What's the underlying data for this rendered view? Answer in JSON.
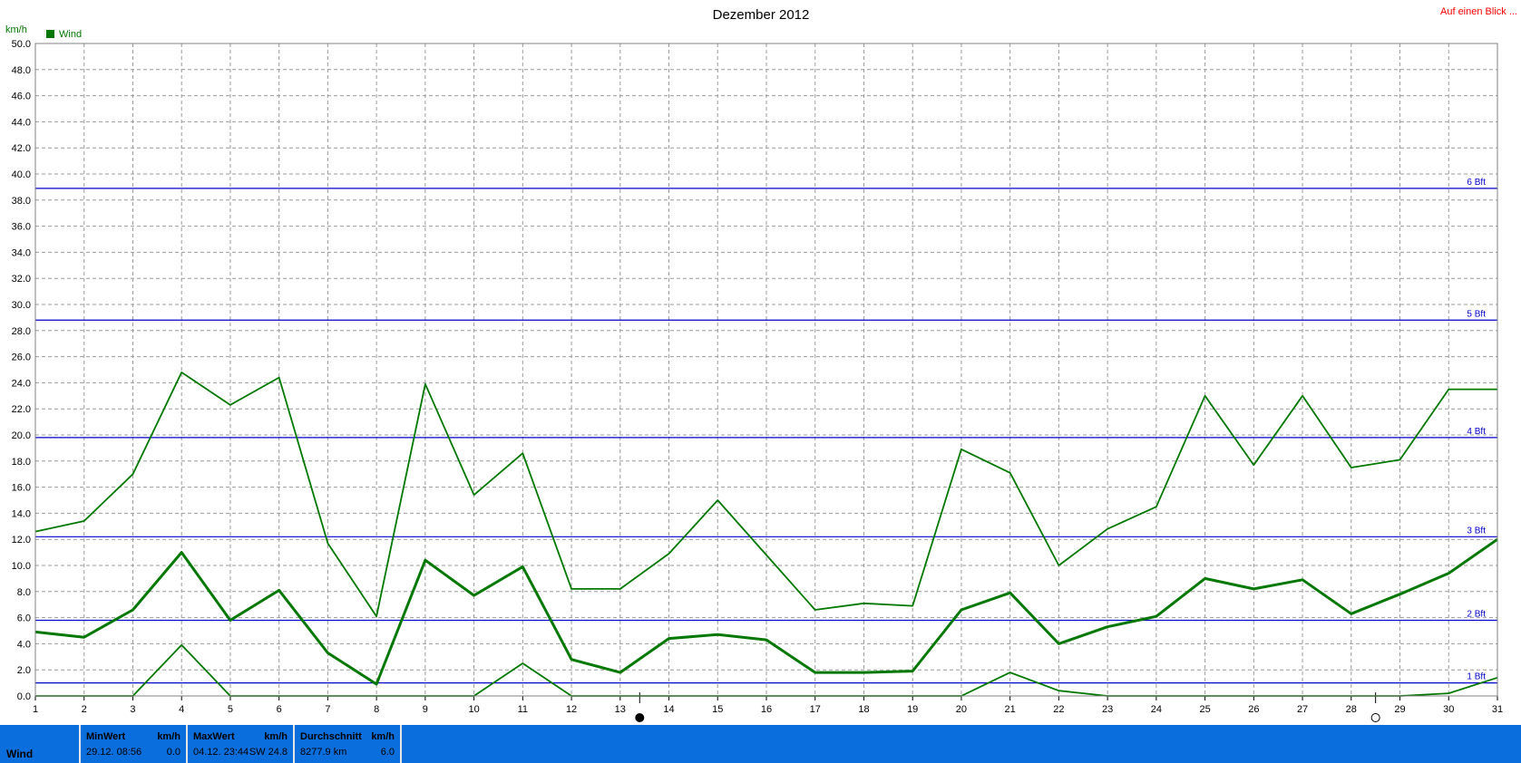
{
  "header": {
    "title": "Dezember 2012",
    "link": "Auf einen Blick ...",
    "y_unit": "km/h"
  },
  "legend": {
    "label": "Wind",
    "color": "#007800"
  },
  "chart_data": {
    "type": "line",
    "title": "Dezember 2012",
    "ylabel": "km/h",
    "ylim": [
      0,
      50
    ],
    "y_ticks": [
      "0.0",
      "2.0",
      "4.0",
      "6.0",
      "8.0",
      "10.0",
      "12.0",
      "14.0",
      "16.0",
      "18.0",
      "20.0",
      "22.0",
      "24.0",
      "26.0",
      "28.0",
      "30.0",
      "32.0",
      "34.0",
      "36.0",
      "38.0",
      "40.0",
      "42.0",
      "44.0",
      "46.0",
      "48.0",
      "50.0"
    ],
    "x": [
      1,
      2,
      3,
      4,
      5,
      6,
      7,
      8,
      9,
      10,
      11,
      12,
      13,
      14,
      15,
      16,
      17,
      18,
      19,
      20,
      21,
      22,
      23,
      24,
      25,
      26,
      27,
      28,
      29,
      30,
      31
    ],
    "grid": true,
    "legend_position": "top-left",
    "series": [
      {
        "name": "Wind",
        "role": "max",
        "color": "#007800",
        "values": [
          12.6,
          13.4,
          17.0,
          24.8,
          22.3,
          24.4,
          11.7,
          6.1,
          23.9,
          15.4,
          18.6,
          8.2,
          8.2,
          10.9,
          15.0,
          10.8,
          6.6,
          7.1,
          6.9,
          18.9,
          17.1,
          10.0,
          12.8,
          14.5,
          23.0,
          17.7,
          23.0,
          17.5,
          18.1,
          23.5,
          23.5
        ]
      },
      {
        "role": "average",
        "color": "#007800",
        "values": [
          4.9,
          4.5,
          6.6,
          11.0,
          5.8,
          8.1,
          3.3,
          0.9,
          10.4,
          7.7,
          9.9,
          2.8,
          1.8,
          4.4,
          4.7,
          4.3,
          1.8,
          1.8,
          1.9,
          6.6,
          7.9,
          4.0,
          5.3,
          6.1,
          9.0,
          8.2,
          8.9,
          6.3,
          7.8,
          9.4,
          12.0
        ]
      },
      {
        "role": "min",
        "color": "#007800",
        "values": [
          0.0,
          0.0,
          0.0,
          3.9,
          0.0,
          0.0,
          0.0,
          0.0,
          0.0,
          0.0,
          2.5,
          0.0,
          0.0,
          0.0,
          0.0,
          0.0,
          0.0,
          0.0,
          0.0,
          0.0,
          1.8,
          0.4,
          0.0,
          0.0,
          0.0,
          0.0,
          0.0,
          0.0,
          0.0,
          0.2,
          1.4
        ]
      }
    ],
    "reference_lines": [
      {
        "label": "1 Bft",
        "value": 1.0,
        "color": "#0000cc"
      },
      {
        "label": "2 Bft",
        "value": 5.8,
        "color": "#0000cc"
      },
      {
        "label": "3 Bft",
        "value": 12.2,
        "color": "#0000cc"
      },
      {
        "label": "4 Bft",
        "value": 19.8,
        "color": "#0000cc"
      },
      {
        "label": "5 Bft",
        "value": 28.8,
        "color": "#0000cc"
      },
      {
        "label": "6 Bft",
        "value": 38.9,
        "color": "#0000cc"
      }
    ],
    "moon_markers": [
      {
        "day": 13.4,
        "phase": "new-moon"
      },
      {
        "day": 28.5,
        "phase": "full-moon"
      }
    ]
  },
  "footer": {
    "series_label": "Wind",
    "min": {
      "header": "MinWert",
      "unit": "km/h",
      "when": "29.12.  08:56",
      "value": "0.0"
    },
    "max": {
      "header": "MaxWert",
      "unit": "km/h",
      "when": "04.12.  23:44",
      "value": "SW 24.8"
    },
    "avg": {
      "header": "Durchschnitt",
      "unit": "km/h",
      "when": "8277.9 km",
      "value": "6.0"
    }
  }
}
